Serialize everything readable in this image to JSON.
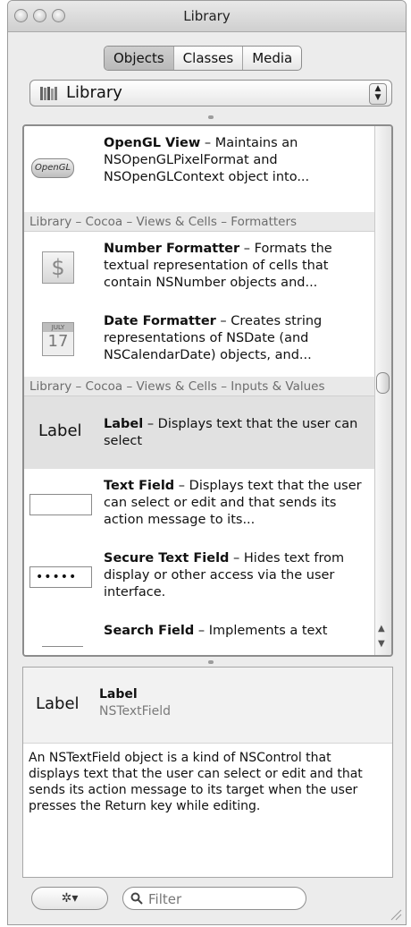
{
  "window": {
    "title": "Library"
  },
  "segments": [
    "Objects",
    "Classes",
    "Media"
  ],
  "popup": {
    "label": "Library"
  },
  "list": {
    "items": [
      {
        "title": "OpenGL View",
        "desc": " – Maintains an NSOpenGLPixelFormat and NSOpenGLContext object into...",
        "icon_text": "OpenGL"
      },
      {
        "section": "Library – Cocoa – Views & Cells – Formatters"
      },
      {
        "title": "Number Formatter",
        "desc": " – Formats the textual representation of cells that contain NSNumber objects and..."
      },
      {
        "title": "Date Formatter",
        "desc": " – Creates string representations of NSDate (and NSCalendarDate) objects, and...",
        "icon_text_month": "JULY",
        "icon_text_day": "17"
      },
      {
        "section": "Library – Cocoa – Views & Cells – Inputs & Values"
      },
      {
        "title": "Label",
        "desc": " – Displays text that the user can select",
        "icon_text": "Label"
      },
      {
        "title": "Text Field",
        "desc": " – Displays text that the user can select or edit and that sends its action message to its..."
      },
      {
        "title": "Secure Text Field",
        "desc": " – Hides text from display or other access via the user interface.",
        "icon_text": "•••••"
      },
      {
        "title": "Search Field",
        "desc": " – Implements a text"
      }
    ]
  },
  "detail": {
    "icon_text": "Label",
    "name": "Label",
    "class": "NSTextField",
    "description": "An NSTextField object is a kind of NSControl that displays text that the user can select or edit and that sends its action message to its target when the user presses the Return key while editing."
  },
  "bottom": {
    "gear_label": "✲▾",
    "filter_placeholder": "Filter"
  }
}
